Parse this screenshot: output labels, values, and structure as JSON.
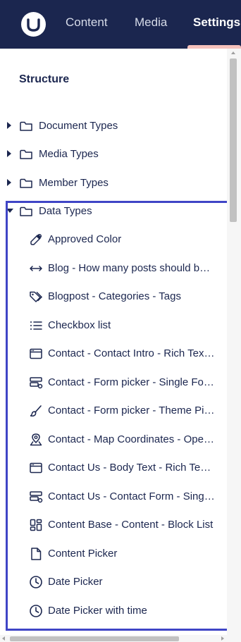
{
  "header": {
    "nav": [
      {
        "label": "Content"
      },
      {
        "label": "Media"
      },
      {
        "label": "Settings"
      }
    ]
  },
  "tree": {
    "title": "Structure",
    "roots": [
      {
        "label": "Document Types",
        "icon": "folder-icon",
        "expanded": false
      },
      {
        "label": "Media Types",
        "icon": "folder-icon",
        "expanded": false
      },
      {
        "label": "Member Types",
        "icon": "folder-icon",
        "expanded": false
      },
      {
        "label": "Data Types",
        "icon": "folder-icon",
        "expanded": true
      }
    ],
    "data_types": [
      {
        "label": "Approved Color",
        "icon": "eyedropper-icon"
      },
      {
        "label": "Blog - How many posts should be shown",
        "icon": "horizontal-arrows-icon"
      },
      {
        "label": "Blogpost - Categories - Tags",
        "icon": "tags-icon"
      },
      {
        "label": "Checkbox list",
        "icon": "list-icon"
      },
      {
        "label": "Contact - Contact Intro - Rich Text Editor",
        "icon": "window-icon"
      },
      {
        "label": "Contact - Form picker - Single Form",
        "icon": "form-icon"
      },
      {
        "label": "Contact - Form picker - Theme Picker",
        "icon": "brush-icon"
      },
      {
        "label": "Contact - Map Coordinates - OpenStreetMap",
        "icon": "map-pin-icon"
      },
      {
        "label": "Contact Us - Body Text - Rich Text Editor",
        "icon": "window-icon"
      },
      {
        "label": "Contact Us - Contact Form - Single Form",
        "icon": "form-icon"
      },
      {
        "label": "Content Base - Content - Block List",
        "icon": "blocks-icon"
      },
      {
        "label": "Content Picker",
        "icon": "document-icon"
      },
      {
        "label": "Date Picker",
        "icon": "clock-icon"
      },
      {
        "label": "Date Picker with time",
        "icon": "clock-icon"
      }
    ]
  },
  "colors": {
    "header_bg": "#1b264f",
    "active_indicator": "#f5c1bc",
    "highlight_border": "#3f45c6",
    "text": "#1b264f"
  }
}
